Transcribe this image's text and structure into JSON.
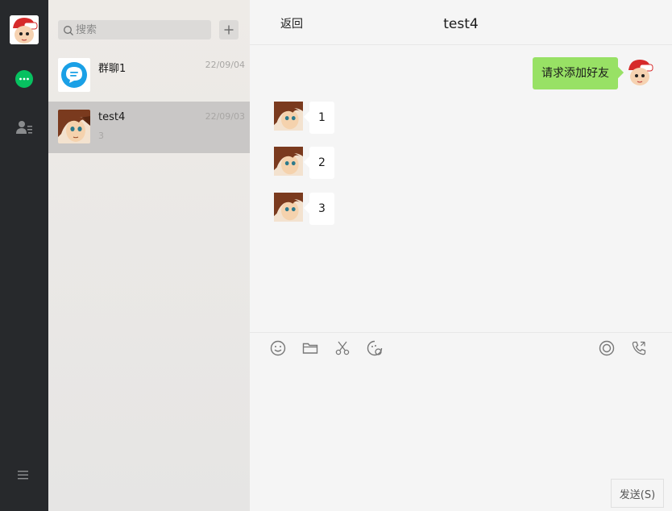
{
  "search": {
    "placeholder": "搜索"
  },
  "sessions": [
    {
      "name": "群聊1",
      "time": "22/09/04",
      "preview": ""
    },
    {
      "name": "test4",
      "time": "22/09/03",
      "preview": "3"
    }
  ],
  "chat": {
    "back_label": "返回",
    "title": "test4",
    "messages": [
      {
        "from": "me",
        "text": "请求添加好友"
      },
      {
        "from": "peer",
        "text": "1"
      },
      {
        "from": "peer",
        "text": "2"
      },
      {
        "from": "peer",
        "text": "3"
      }
    ],
    "send_label": "发送(S)"
  },
  "colors": {
    "nav_bg": "#27292c",
    "accent_green": "#07c160",
    "bubble_me": "#98e165",
    "active_session": "#c9c7c6"
  },
  "icons": [
    "chat-icon",
    "contacts-icon",
    "menu-icon",
    "search-icon",
    "plus-icon",
    "emoji-icon",
    "folder-icon",
    "scissors-icon",
    "sticker-icon",
    "video-call-icon",
    "voice-call-icon"
  ]
}
